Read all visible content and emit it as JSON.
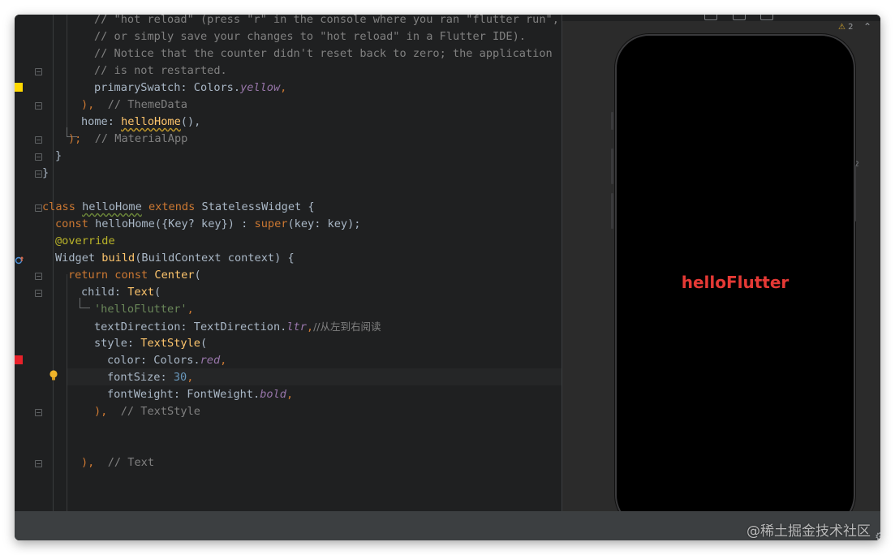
{
  "colors": {
    "editor_bg": "#1f2021",
    "panel_bg": "#2b2b2b",
    "keyword": "#cc7832",
    "comment": "#808080",
    "string": "#6a8759",
    "number": "#6897bb",
    "field": "#9876aa",
    "annotation": "#bbb529",
    "function": "#ffc66d",
    "plain": "#a9b7c6",
    "marker_yellow": "#ffd800",
    "marker_red": "#e8212a",
    "flutter_text_red": "#e53935"
  },
  "code": {
    "l1_comment": "// \"hot reload\" (press \"r\" in the console where you ran \"flutter run\",",
    "l2_comment": "// or simply save your changes to \"hot reload\" in a Flutter IDE).",
    "l3_comment": "// Notice that the counter didn't reset back to zero; the application",
    "l4_comment": "// is not restarted.",
    "l5_prop": "primarySwatch: Colors.",
    "l5_field": "yellow",
    "l5_tail": ",",
    "l6_close": "),",
    "l6_comment": "// ThemeData",
    "l7_prop": "home: ",
    "l7_fn": "helloHome",
    "l7_tail": "(),",
    "l8_close": ");",
    "l8_comment": "// MaterialApp",
    "l9": "}",
    "l10": "}",
    "l11_kw1": "class",
    "l11_name": "helloHome",
    "l11_kw2": "extends",
    "l11_rest": "StatelessWidget {",
    "l12_kw": "const",
    "l12_mid": "helloHome({Key? key}) : ",
    "l12_super": "super",
    "l12_tail": "(key: key);",
    "l13_ann": "@override",
    "l14_type": "Widget ",
    "l14_fn": "build",
    "l14_tail": "(BuildContext context) {",
    "l15_kw": "return const",
    "l15_fn": "Center",
    "l15_tail": "(",
    "l16_prop": "child: ",
    "l16_fn": "Text",
    "l16_tail": "(",
    "l17_str": "'helloFlutter'",
    "l17_tail": ",",
    "l18_prop": "textDirection: TextDirection.",
    "l18_field": "ltr",
    "l18_tail": ",",
    "l18_comment": "//从左到右阅读",
    "l19_prop": "style: ",
    "l19_fn": "TextStyle",
    "l19_tail": "(",
    "l20_prop": "color: Colors.",
    "l20_field": "red",
    "l20_tail": ",",
    "l21_prop": "fontSize: ",
    "l21_num": "30",
    "l21_tail": ",",
    "l22_prop": "fontWeight: FontWeight.",
    "l22_field": "bold",
    "l22_tail": ",",
    "l23_close": "),",
    "l23_comment": "// TextStyle",
    "l24_close": "),",
    "l24_comment": "// Text"
  },
  "emulator": {
    "display_text": "helloFlutter"
  },
  "ide": {
    "warning_count": "2",
    "scroll_marker": "2"
  },
  "watermark": "@稀土掘金技术社区"
}
